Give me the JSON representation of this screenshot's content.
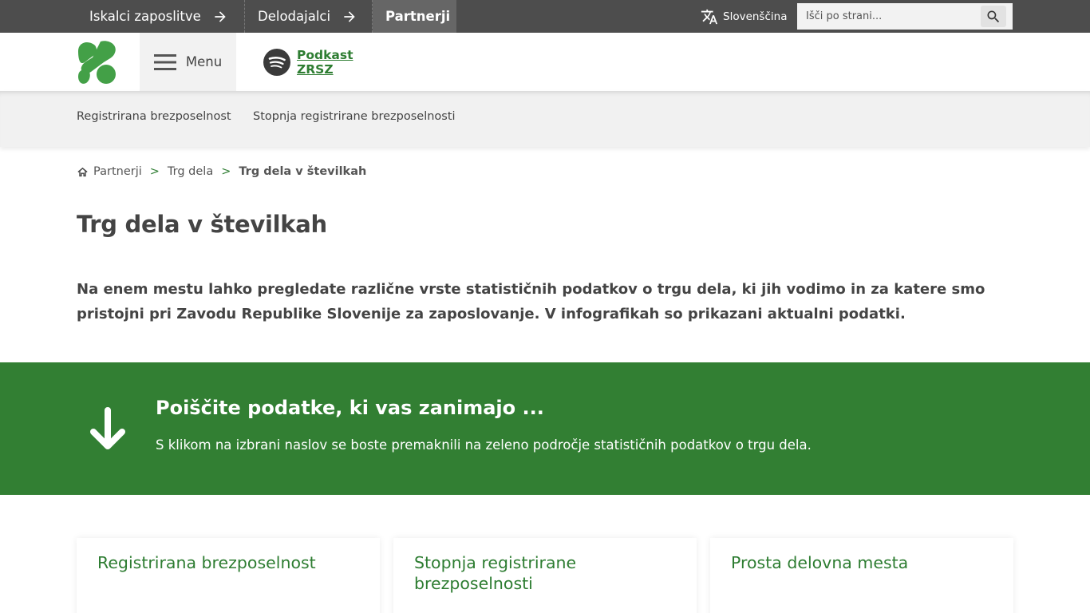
{
  "topbar": {
    "nav": [
      {
        "label": "Iskalci zaposlitve"
      },
      {
        "label": "Delodajalci"
      },
      {
        "label": "Partnerji"
      }
    ],
    "language": "Slovenščina",
    "search_placeholder": "Išči po strani..."
  },
  "header": {
    "menu_label": "Menu",
    "podcast_label": "Podkast ZRSZ"
  },
  "subnav": {
    "items": [
      {
        "label": "Registrirana brezposelnost"
      },
      {
        "label": "Stopnja registrirane brezposelnosti"
      }
    ]
  },
  "breadcrumb": {
    "items": [
      "Partnerji",
      "Trg dela",
      "Trg dela v številkah"
    ],
    "separator": ">"
  },
  "main": {
    "title": "Trg dela v številkah",
    "intro": "Na enem mestu lahko pregledate različne vrste statističnih podatkov o trgu dela, ki jih vodimo in za katere smo pristojni pri Zavodu Republike Slovenije za zaposlovanje. V infografikah so prikazani aktualni podatki."
  },
  "band": {
    "title": "Poiščite podatke, ki vas zanimajo ...",
    "text": "S klikom na izbrani naslov se boste premaknili na zeleno področje statističnih podatkov o trgu dela."
  },
  "cards": [
    {
      "title": "Registrirana brezposelnost"
    },
    {
      "title": "Stopnja registrirane brezposelnosti"
    },
    {
      "title": "Prosta delovna mesta"
    }
  ],
  "colors": {
    "brand_green": "#327f33",
    "topbar_bg": "#4d4d4d",
    "link_green": "#2e7d32"
  },
  "icons": [
    "arrow-right-icon",
    "translate-icon",
    "search-icon",
    "hamburger-icon",
    "spotify-icon",
    "home-icon",
    "arrow-down-icon"
  ]
}
